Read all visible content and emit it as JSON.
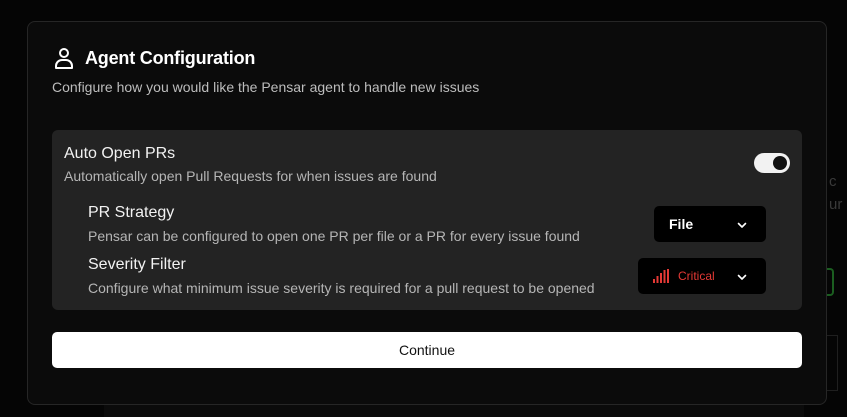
{
  "modal": {
    "title": "Agent Configuration",
    "subtitle": "Configure how you would like the Pensar agent to handle new issues",
    "title_icon": "user-icon"
  },
  "auto_open_prs": {
    "label": "Auto Open PRs",
    "description": "Automatically open Pull Requests for when issues are found",
    "enabled": true
  },
  "pr_strategy": {
    "label": "PR Strategy",
    "description": "Pensar can be configured to open one PR per file or a PR for every issue found",
    "selected": "File"
  },
  "severity_filter": {
    "label": "Severity Filter",
    "description": "Configure what minimum issue severity is required for a pull request to be opened",
    "selected": "Critical",
    "icon": "signal-bars-icon",
    "color": "#e53935"
  },
  "continue_label": "Continue",
  "background": {
    "fragment_1": "c",
    "fragment_2": "ur"
  },
  "colors": {
    "accent_critical": "#e53935",
    "panel": "#232323",
    "button": "#ffffff"
  }
}
